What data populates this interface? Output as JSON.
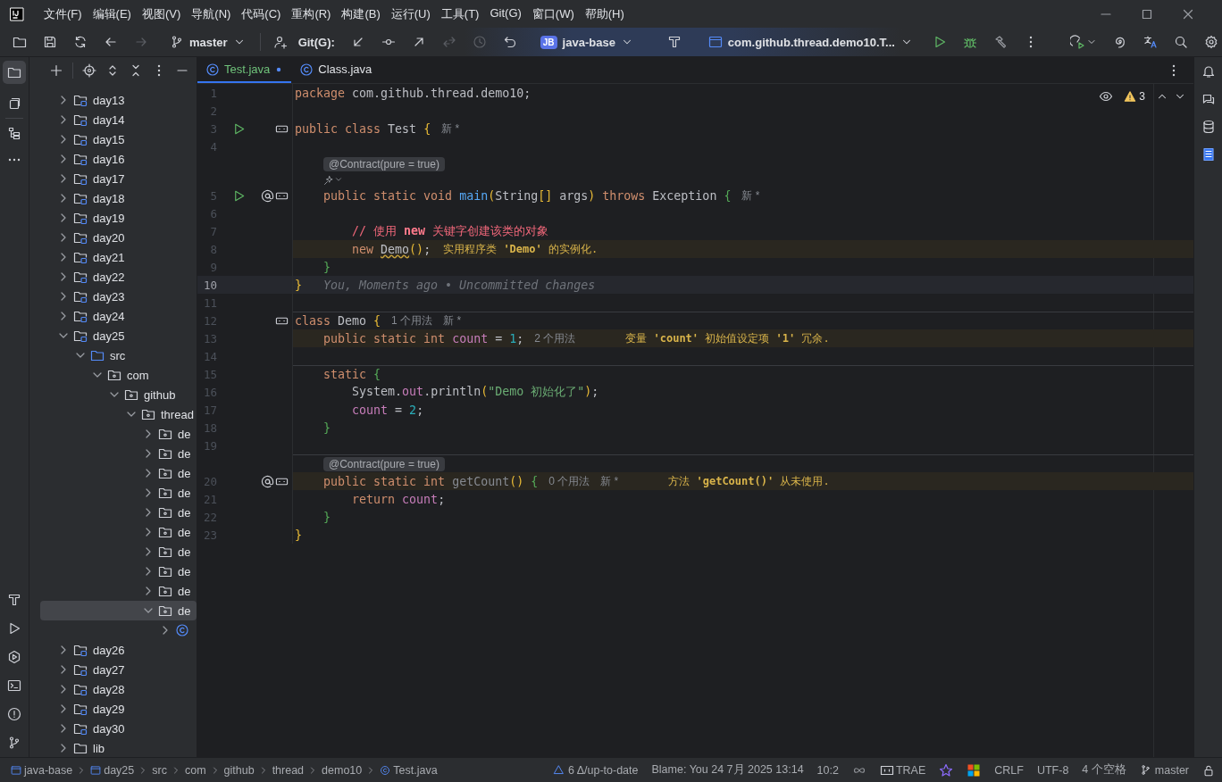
{
  "title_bar": {
    "menus": [
      "文件(F)",
      "编辑(E)",
      "视图(V)",
      "导航(N)",
      "代码(C)",
      "重构(R)",
      "构建(B)",
      "运行(U)",
      "工具(T)",
      "Git(G)",
      "窗口(W)",
      "帮助(H)"
    ]
  },
  "toolbar": {
    "branch": "master",
    "git_label": "Git(G):",
    "git_actions": [
      {
        "kind": "update",
        "disabled": false
      },
      {
        "kind": "commit",
        "disabled": false
      },
      {
        "kind": "push",
        "disabled": false
      },
      {
        "kind": "fetch",
        "disabled": true
      },
      {
        "kind": "history",
        "disabled": true
      },
      {
        "kind": "rollback",
        "disabled": false
      }
    ],
    "project": {
      "badge": "JB",
      "name": "java-base"
    },
    "run_config": "com.github.thread.demo10.T..."
  },
  "project_tree": [
    {
      "label": "day13",
      "kind": "module",
      "expanded": false,
      "selected": false
    },
    {
      "label": "day14",
      "kind": "module",
      "expanded": false,
      "selected": false
    },
    {
      "label": "day15",
      "kind": "module",
      "expanded": false,
      "selected": false
    },
    {
      "label": "day16",
      "kind": "module",
      "expanded": false,
      "selected": false
    },
    {
      "label": "day17",
      "kind": "module",
      "expanded": false,
      "selected": false
    },
    {
      "label": "day18",
      "kind": "module",
      "expanded": false,
      "selected": false
    },
    {
      "label": "day19",
      "kind": "module",
      "expanded": false,
      "selected": false
    },
    {
      "label": "day20",
      "kind": "module",
      "expanded": false,
      "selected": false
    },
    {
      "label": "day21",
      "kind": "module",
      "expanded": false,
      "selected": false
    },
    {
      "label": "day22",
      "kind": "module",
      "expanded": false,
      "selected": false
    },
    {
      "label": "day23",
      "kind": "module",
      "expanded": false,
      "selected": false
    },
    {
      "label": "day24",
      "kind": "module",
      "expanded": false,
      "selected": false
    },
    {
      "label": "day25",
      "kind": "module",
      "expanded": true,
      "selected": false,
      "children": [
        {
          "label": "src",
          "kind": "source",
          "expanded": true,
          "selected": false,
          "children": [
            {
              "label": "com",
              "kind": "package",
              "expanded": true,
              "selected": false,
              "children": [
                {
                  "label": "github",
                  "kind": "package",
                  "expanded": true,
                  "selected": false,
                  "children": [
                    {
                      "label": "thread",
                      "kind": "package",
                      "expanded": true,
                      "selected": false,
                      "children": [
                        {
                          "label": "de",
                          "kind": "package",
                          "expanded": false,
                          "selected": false
                        },
                        {
                          "label": "de",
                          "kind": "package",
                          "expanded": false,
                          "selected": false
                        },
                        {
                          "label": "de",
                          "kind": "package",
                          "expanded": false,
                          "selected": false
                        },
                        {
                          "label": "de",
                          "kind": "package",
                          "expanded": false,
                          "selected": false
                        },
                        {
                          "label": "de",
                          "kind": "package",
                          "expanded": false,
                          "selected": false
                        },
                        {
                          "label": "de",
                          "kind": "package",
                          "expanded": false,
                          "selected": false
                        },
                        {
                          "label": "de",
                          "kind": "package",
                          "expanded": false,
                          "selected": false
                        },
                        {
                          "label": "de",
                          "kind": "package",
                          "expanded": false,
                          "selected": false
                        },
                        {
                          "label": "de",
                          "kind": "package",
                          "expanded": false,
                          "selected": false
                        },
                        {
                          "label": "de",
                          "kind": "package",
                          "expanded": true,
                          "selected": true,
                          "children": [
                            {
                              "kind": "class",
                              "expanded": false,
                              "selected": false
                            }
                          ]
                        }
                      ]
                    }
                  ]
                }
              ]
            }
          ]
        }
      ]
    },
    {
      "label": "day26",
      "kind": "module",
      "expanded": false,
      "selected": false
    },
    {
      "label": "day27",
      "kind": "module",
      "expanded": false,
      "selected": false
    },
    {
      "label": "day28",
      "kind": "module",
      "expanded": false,
      "selected": false
    },
    {
      "label": "day29",
      "kind": "module",
      "expanded": false,
      "selected": false
    },
    {
      "label": "day30",
      "kind": "module",
      "expanded": false,
      "selected": false
    },
    {
      "label": "lib",
      "kind": "folder",
      "expanded": false,
      "selected": false
    }
  ],
  "editor": {
    "tabs": [
      {
        "label": "Test.java",
        "selected": true,
        "modified": true
      },
      {
        "label": "Class.java",
        "selected": false,
        "modified": false
      }
    ],
    "problems": {
      "count": "3"
    },
    "lines": [
      {
        "kind": "code",
        "number": "1",
        "tokens": [
          {
            "kind": "keyword",
            "text": "package"
          },
          {
            "kind": "plain",
            "text": " com.github.thread.demo10;"
          }
        ]
      },
      {
        "kind": "code",
        "number": "2"
      },
      {
        "kind": "code",
        "number": "3",
        "run_button": true,
        "structure_marker": true,
        "tokens": [
          {
            "kind": "keyword",
            "text": "public class"
          },
          {
            "kind": "plain",
            "text": " Test "
          },
          {
            "kind": "brace_outer",
            "text": "{"
          },
          {
            "kind": "hint",
            "text": "新 *"
          }
        ]
      },
      {
        "kind": "code",
        "number": "4"
      },
      {
        "kind": "annotation",
        "text": "@Contract(pure = true)"
      },
      {
        "kind": "ai-hint"
      },
      {
        "kind": "code",
        "number": "5",
        "run_button": true,
        "annotation_marker": true,
        "structure_marker": true,
        "tokens": [
          {
            "kind": "keyword",
            "text": "    public static void"
          },
          {
            "kind": "function",
            "text": " main"
          },
          {
            "kind": "brace_outer",
            "text": "("
          },
          {
            "kind": "plain",
            "text": "String"
          },
          {
            "kind": "brace_outer",
            "text": "[]"
          },
          {
            "kind": "plain",
            "text": " args"
          },
          {
            "kind": "brace_outer",
            "text": ")"
          },
          {
            "kind": "keyword",
            "text": " throws"
          },
          {
            "kind": "plain",
            "text": " Exception "
          },
          {
            "kind": "brace_inner",
            "text": "{"
          },
          {
            "kind": "hint",
            "text": "新 *"
          }
        ]
      },
      {
        "kind": "code",
        "number": "6"
      },
      {
        "kind": "code",
        "number": "7",
        "tokens": [
          {
            "kind": "comment",
            "text": "        // 使用 "
          },
          {
            "kind": "comment_keyword",
            "text": "new"
          },
          {
            "kind": "comment",
            "text": " 关键字创建该类的对象"
          }
        ]
      },
      {
        "kind": "code",
        "number": "8",
        "warning": true,
        "tokens": [
          {
            "kind": "keyword",
            "text": "        new "
          },
          {
            "kind": "warning_ref",
            "text": "Demo"
          },
          {
            "kind": "brace_outer",
            "text": "()"
          },
          {
            "kind": "plain",
            "text": ";"
          },
          {
            "kind": "problem",
            "text": "实用程序类 **'Demo'** 的实例化."
          }
        ]
      },
      {
        "kind": "code",
        "number": "9",
        "tokens": [
          {
            "kind": "brace_inner",
            "text": "    }"
          }
        ]
      },
      {
        "kind": "code",
        "number": "10",
        "current": true,
        "tokens": [
          {
            "kind": "brace_outer",
            "text": "}"
          },
          {
            "kind": "blame",
            "text": "You, Moments ago • Uncommitted changes"
          }
        ]
      },
      {
        "kind": "code",
        "number": "11"
      },
      {
        "kind": "code",
        "number": "12",
        "separator": true,
        "structure_marker": true,
        "tokens": [
          {
            "kind": "keyword",
            "text": "class"
          },
          {
            "kind": "plain",
            "text": " Demo "
          },
          {
            "kind": "brace_outer",
            "text": "{"
          },
          {
            "kind": "usage",
            "text": "1 个用法"
          },
          {
            "kind": "hint",
            "text": "新 *"
          }
        ]
      },
      {
        "kind": "code",
        "number": "13",
        "warning": true,
        "tokens": [
          {
            "kind": "keyword",
            "text": "    public static int"
          },
          {
            "kind": "field",
            "text": " count"
          },
          {
            "kind": "plain",
            "text": " = "
          },
          {
            "kind": "number",
            "text": "1"
          },
          {
            "kind": "plain",
            "text": ";"
          },
          {
            "kind": "usage",
            "text": "2 个用法"
          },
          {
            "kind": "problem",
            "text": "变量 **'count'** 初始值设定项 **'1'** 冗余."
          }
        ]
      },
      {
        "kind": "code",
        "number": "14"
      },
      {
        "kind": "code",
        "number": "15",
        "separator": true,
        "tokens": [
          {
            "kind": "keyword",
            "text": "    static"
          },
          {
            "kind": "brace_inner",
            "text": " {"
          }
        ]
      },
      {
        "kind": "code",
        "number": "16",
        "tokens": [
          {
            "kind": "plain",
            "text": "        System."
          },
          {
            "kind": "field",
            "text": "out"
          },
          {
            "kind": "plain",
            "text": ".println"
          },
          {
            "kind": "brace_outer",
            "text": "("
          },
          {
            "kind": "string",
            "text": "\"Demo 初始化了\""
          },
          {
            "kind": "brace_outer",
            "text": ")"
          },
          {
            "kind": "plain",
            "text": ";"
          }
        ]
      },
      {
        "kind": "code",
        "number": "17",
        "tokens": [
          {
            "kind": "field",
            "text": "        count"
          },
          {
            "kind": "plain",
            "text": " = "
          },
          {
            "kind": "number",
            "text": "2"
          },
          {
            "kind": "plain",
            "text": ";"
          }
        ]
      },
      {
        "kind": "code",
        "number": "18",
        "tokens": [
          {
            "kind": "brace_inner",
            "text": "    }"
          }
        ]
      },
      {
        "kind": "code",
        "number": "19"
      },
      {
        "kind": "annotation",
        "separator": true,
        "text": "@Contract(pure = true)"
      },
      {
        "kind": "code",
        "number": "20",
        "warning": true,
        "annotation_marker": true,
        "structure_marker": true,
        "tokens": [
          {
            "kind": "keyword",
            "text": "    public static int"
          },
          {
            "kind": "unused",
            "text": " getCount"
          },
          {
            "kind": "brace_outer",
            "text": "()"
          },
          {
            "kind": "brace_inner",
            "text": " {"
          },
          {
            "kind": "usage",
            "text": "0 个用法"
          },
          {
            "kind": "hint",
            "text": "新 *"
          },
          {
            "kind": "problem",
            "text": "方法 **'getCount()'** 从未使用."
          }
        ]
      },
      {
        "kind": "code",
        "number": "21",
        "tokens": [
          {
            "kind": "keyword",
            "text": "        return"
          },
          {
            "kind": "field",
            "text": " count"
          },
          {
            "kind": "plain",
            "text": ";"
          }
        ]
      },
      {
        "kind": "code",
        "number": "22",
        "tokens": [
          {
            "kind": "brace_inner",
            "text": "    }"
          }
        ]
      },
      {
        "kind": "code",
        "number": "23",
        "tokens": [
          {
            "kind": "brace_outer",
            "text": "}"
          }
        ]
      }
    ]
  },
  "status_bar": {
    "breadcrumbs": [
      {
        "label": "java-base",
        "kind": "module"
      },
      {
        "label": "day25",
        "kind": "module"
      },
      {
        "label": "src",
        "kind": "folder"
      },
      {
        "label": "com",
        "kind": "folder"
      },
      {
        "label": "github",
        "kind": "folder"
      },
      {
        "label": "thread",
        "kind": "folder"
      },
      {
        "label": "demo10",
        "kind": "folder"
      },
      {
        "label": "Test.java",
        "kind": "class"
      }
    ],
    "vcs": "6 Δ/up-to-date",
    "blame": "Blame: You 24 7月 2025 13:14",
    "position": "10:2",
    "plugin": "TRAE",
    "line_separator": "CRLF",
    "encoding": "UTF-8",
    "indent": "4 个空格",
    "branch": "master"
  }
}
